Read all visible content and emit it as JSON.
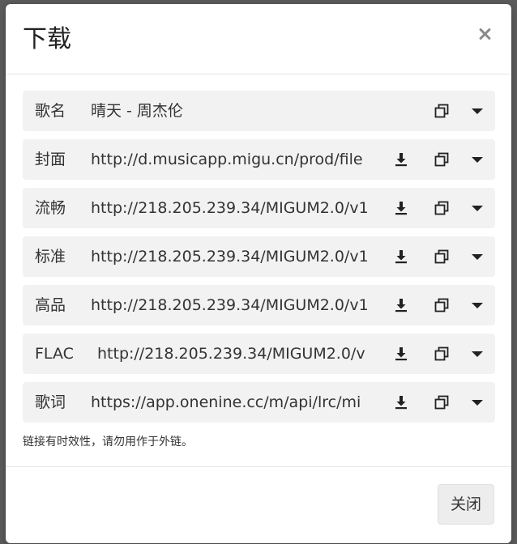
{
  "modal": {
    "title": "下载",
    "note": "链接有时效性，请勿用作于外链。",
    "close_button": "关闭"
  },
  "rows": [
    {
      "label": "歌名",
      "value": "晴天 - 周杰伦",
      "has_download": false
    },
    {
      "label": "封面",
      "value": "http://d.musicapp.migu.cn/prod/file",
      "has_download": true
    },
    {
      "label": "流畅",
      "value": "http://218.205.239.34/MIGUM2.0/v1",
      "has_download": true
    },
    {
      "label": "标准",
      "value": "http://218.205.239.34/MIGUM2.0/v1",
      "has_download": true
    },
    {
      "label": "高品",
      "value": "http://218.205.239.34/MIGUM2.0/v1",
      "has_download": true
    },
    {
      "label": "FLAC",
      "value": "http://218.205.239.34/MIGUM2.0/v",
      "has_download": true
    },
    {
      "label": "歌词",
      "value": "https://app.onenine.cc/m/api/lrc/mi",
      "has_download": true
    }
  ],
  "colors": {
    "row_background": "#f2f2f2",
    "icon": "#222222",
    "backdrop": "#5b5b5b"
  },
  "icons": {
    "download": "download-icon",
    "copy": "copy-icon",
    "caret": "caret-down-icon",
    "close": "close-icon"
  }
}
